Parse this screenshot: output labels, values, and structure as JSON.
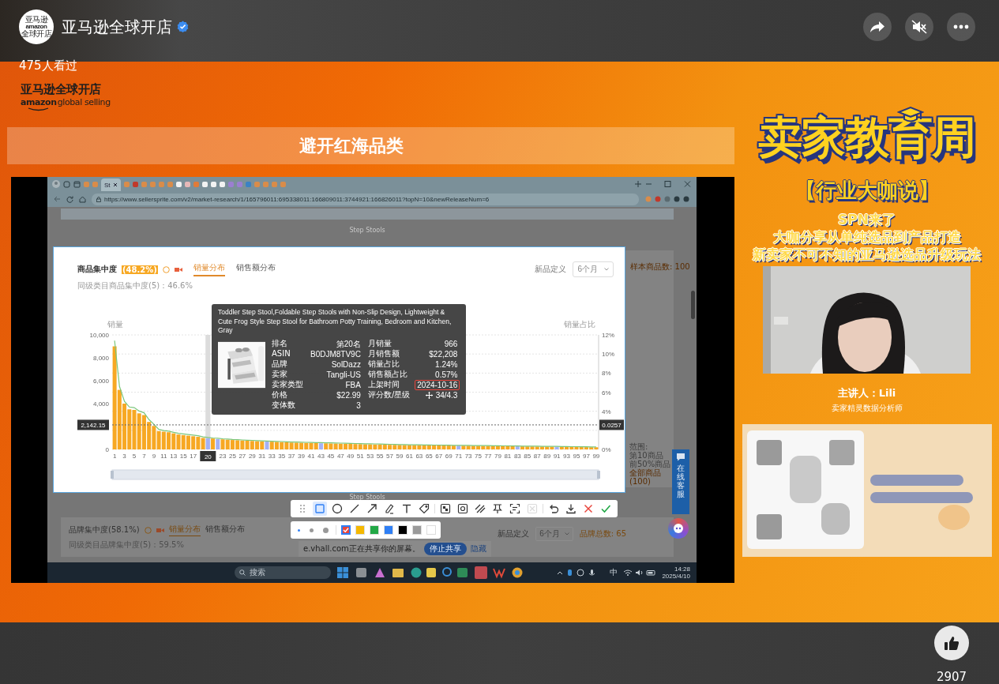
{
  "header": {
    "avatar_text": [
      "亚马逊",
      "amazon",
      "全球开店"
    ],
    "name": "亚马逊全球开店",
    "verified": true
  },
  "actions": [
    {
      "kind": "share"
    },
    {
      "kind": "mute"
    },
    {
      "kind": "more"
    }
  ],
  "views": "475人看过",
  "logo": {
    "cn": "亚马逊全球开店",
    "en_bold": "amazon",
    "en": "global selling"
  },
  "slide_title": "避开红海品类",
  "screen": {
    "browser": {
      "tabs": [
        {
          "label": "St",
          "selected": true
        }
      ],
      "url": "https://www.sellersprite.com/v2/market-research/1/165796011:695338011:166809011:3744921:166826011?topN=10&newReleaseNum=6"
    },
    "top_caption": "Step Stools",
    "concentration_card": {
      "title": "商品集中度",
      "badge": "(48.2%)",
      "tabs": [
        {
          "label": "销量分布",
          "selected": true
        },
        {
          "label": "销售额分布",
          "selected": false
        }
      ],
      "subtitle": "同级类目商品集中度(5)：46.6%",
      "new_def_label": "新品定义",
      "new_def_value": "6个月",
      "right_axis": {
        "label": "销量占比",
        "ticks": [
          "12%",
          "10%",
          "8%",
          "6%",
          "4%",
          "0%"
        ]
      },
      "pointer": {
        "x_label": "20",
        "left_label": "2,142.15",
        "right_label": "0.0257"
      },
      "chart_data": {
        "type": "bar",
        "ylabel": "销量",
        "stacked": true,
        "xlim": [
          0.5,
          99.5
        ],
        "ref_lines": [
          {
            "axis": "y",
            "value": 2142.15
          }
        ],
        "x": [
          1,
          2,
          3,
          4,
          5,
          6,
          7,
          8,
          9,
          10,
          11,
          12,
          13,
          14,
          15,
          16,
          17,
          18,
          19,
          20,
          21,
          22,
          23,
          24,
          25,
          26,
          27,
          28,
          29,
          30,
          31,
          32,
          33,
          34,
          35,
          36,
          37,
          38,
          39,
          40,
          41,
          42,
          43,
          44,
          45,
          46,
          47,
          48,
          49,
          50,
          51,
          52,
          53,
          54,
          55,
          56,
          57,
          58,
          59,
          60,
          61,
          62,
          63,
          64,
          65,
          66,
          67,
          68,
          69,
          70,
          71,
          72,
          73,
          74,
          75,
          76,
          77,
          78,
          79,
          80,
          81,
          82,
          83,
          84,
          85,
          86,
          87,
          88,
          89,
          90,
          91,
          92,
          93,
          94,
          95,
          96,
          97,
          98,
          99
        ],
        "xticks": [
          1,
          3,
          5,
          7,
          9,
          11,
          13,
          15,
          17,
          23,
          25,
          27,
          29,
          31,
          33,
          35,
          37,
          39,
          41,
          43,
          45,
          47,
          49,
          51,
          53,
          55,
          57,
          59,
          61,
          63,
          65,
          67,
          69,
          71,
          73,
          75,
          77,
          79,
          81,
          83,
          85,
          87,
          89,
          91,
          93,
          95,
          97,
          99
        ],
        "ylim": [
          0,
          10000
        ],
        "yticks": [
          {
            "value": 0,
            "label": "0"
          },
          {
            "value": 4000,
            "label": "4,000"
          },
          {
            "value": 6000,
            "label": "6,000"
          },
          {
            "value": 8000,
            "label": "8,000"
          },
          {
            "value": 10000,
            "label": "10,000"
          }
        ],
        "series": [
          {
            "color": "#f7a823",
            "values": [
              9000,
              5200,
              4000,
              3500,
              3450,
              3150,
              3000,
              2400,
              2050,
              1600,
              1550,
              1500,
              1400,
              1300,
              1250,
              1200,
              1150,
              1100,
              1000,
              null,
              950,
              null,
              880,
              850,
              820,
              800,
              780,
              760,
              740,
              720,
              700,
              null,
              680,
              660,
              640,
              620,
              600,
              590,
              580,
              570,
              560,
              550,
              null,
              530,
              520,
              510,
              500,
              490,
              480,
              470,
              460,
              450,
              440,
              430,
              420,
              410,
              400,
              395,
              390,
              385,
              380,
              375,
              370,
              365,
              360,
              355,
              350,
              345,
              340,
              335,
              null,
              325,
              320,
              315,
              310,
              305,
              300,
              295,
              290,
              285,
              280,
              275,
              null,
              265,
              260,
              255,
              250,
              245,
              240,
              235,
              null,
              225,
              220,
              215,
              210,
              205,
              200,
              195,
              190
            ]
          },
          {
            "color": "#a3b1f5",
            "values": [
              null,
              null,
              null,
              null,
              null,
              null,
              null,
              null,
              null,
              null,
              null,
              null,
              null,
              null,
              null,
              null,
              null,
              null,
              null,
              966,
              null,
              900,
              null,
              null,
              null,
              null,
              null,
              null,
              null,
              null,
              null,
              690,
              null,
              null,
              null,
              null,
              null,
              null,
              null,
              null,
              null,
              null,
              540,
              null,
              null,
              null,
              null,
              null,
              null,
              null,
              null,
              null,
              null,
              null,
              null,
              null,
              null,
              null,
              null,
              null,
              null,
              null,
              null,
              null,
              null,
              null,
              null,
              null,
              null,
              null,
              330,
              null,
              null,
              null,
              null,
              null,
              null,
              null,
              null,
              null,
              null,
              null,
              270,
              null,
              null,
              null,
              null,
              null,
              null,
              null,
              230,
              null,
              null,
              null,
              null,
              null,
              null,
              null,
              null
            ]
          },
          {
            "type": "line",
            "color": "#7bc67b",
            "values": [
              9500,
              5500,
              4200,
              3700,
              3650,
              3350,
              3200,
              2600,
              2200,
              1750,
              1650,
              1600,
              1500,
              1400,
              1350,
              1300,
              1250,
              1200,
              1100,
              1050,
              1000,
              970,
              930,
              900,
              870,
              850,
              830,
              810,
              790,
              770,
              750,
              740,
              720,
              700,
              690,
              670,
              650,
              640,
              630,
              620,
              610,
              600,
              590,
              580,
              570,
              560,
              550,
              540,
              530,
              520,
              510,
              500,
              490,
              480,
              470,
              460,
              450,
              440,
              430,
              420,
              410,
              400,
              400,
              390,
              390,
              380,
              380,
              370,
              370,
              360,
              360,
              350,
              350,
              340,
              340,
              330,
              330,
              320,
              320,
              310,
              310,
              300,
              300,
              290,
              290,
              280,
              280,
              270,
              270,
              260,
              260,
              250,
              250,
              240,
              240,
              230,
              230,
              220,
              220
            ]
          }
        ]
      },
      "tooltip": {
        "title": "Toddler Step Stool,Foldable Step Stools with Non-Slip Design, Lightweight & Cute Frog Style Step Stool for Bathroom Potty Training, Bedroom and Kitchen, Gray",
        "left": [
          {
            "label": "排名",
            "value": "第20名"
          },
          {
            "label": "ASIN",
            "value": "B0DJM8TV9C"
          },
          {
            "label": "品牌",
            "value": "SolDazz"
          },
          {
            "label": "卖家",
            "value": "Tangli-US"
          },
          {
            "label": "卖家类型",
            "value": "FBA"
          },
          {
            "label": "价格",
            "value": "$22.99"
          },
          {
            "label": "变体数",
            "value": "3"
          }
        ],
        "right": [
          {
            "label": "月销量",
            "value": "966",
            "highlighted": false
          },
          {
            "label": "月销售额",
            "value": "$22,208",
            "highlighted": false
          },
          {
            "label": "销量占比",
            "value": "1.24%",
            "highlighted": false
          },
          {
            "label": "销售额占比",
            "value": "0.57%",
            "highlighted": false
          },
          {
            "label": "上架时间",
            "value": "2024-10-16",
            "highlighted": true
          },
          {
            "label": "评分数/星级",
            "value": "34/4.3",
            "highlighted": false
          }
        ]
      }
    },
    "sample_count": "样本商品数: 100",
    "range_legend": {
      "title": "范围:",
      "items": [
        "第10商品",
        "前50%商品",
        "全部商品(100)"
      ]
    },
    "bottom_caption": "Step Stools",
    "brand_card": {
      "title": "品牌集中度(58.1%)",
      "tabs": [
        {
          "label": "销量分布",
          "selected": true
        },
        {
          "label": "销售额分布",
          "selected": false
        }
      ],
      "subtitle": "同级类目品牌集中度(5)：59.5%",
      "new_def_label": "新品定义",
      "new_def_value": "6个月",
      "brand_count": "品牌总数: 65"
    },
    "support": "在线客服",
    "toolbar": {
      "tools": [
        {
          "kind": "drag",
          "selected": false,
          "disabled": false
        },
        {
          "kind": "rect",
          "selected": true,
          "disabled": false
        },
        {
          "kind": "ellipse",
          "selected": false,
          "disabled": false
        },
        {
          "kind": "line",
          "selected": false,
          "disabled": false
        },
        {
          "kind": "arrow",
          "selected": false,
          "disabled": false
        },
        {
          "kind": "pen",
          "selected": false,
          "disabled": false
        },
        {
          "kind": "text",
          "selected": false,
          "disabled": false
        },
        {
          "kind": "tag",
          "selected": false,
          "disabled": false
        },
        {
          "kind": "mosaic",
          "selected": false,
          "disabled": false
        },
        {
          "kind": "blur",
          "selected": false,
          "disabled": false
        },
        {
          "kind": "hatch",
          "selected": false,
          "disabled": false
        },
        {
          "kind": "pin",
          "selected": false,
          "disabled": false
        },
        {
          "kind": "ocr",
          "selected": false,
          "disabled": false
        },
        {
          "kind": "translate",
          "selected": false,
          "disabled": true
        },
        {
          "kind": "undo",
          "selected": false,
          "disabled": false
        },
        {
          "kind": "download",
          "selected": false,
          "disabled": false
        },
        {
          "kind": "cancel",
          "selected": false,
          "disabled": false
        },
        {
          "kind": "confirm",
          "selected": false,
          "disabled": false
        }
      ]
    },
    "palette": {
      "sizes": [
        {
          "kind": "small",
          "selected": true
        },
        {
          "kind": "medium",
          "selected": false
        },
        {
          "kind": "large",
          "selected": false
        }
      ],
      "colors": [
        {
          "color": "#e8453c",
          "selected": true
        },
        {
          "color": "#f5b800",
          "selected": false
        },
        {
          "color": "#22a846",
          "selected": false
        },
        {
          "color": "#2f7ff5",
          "selected": false
        },
        {
          "color": "#000000",
          "selected": false
        },
        {
          "color": "#9a9a9a",
          "selected": false
        },
        {
          "color": "#ffffff",
          "selected": false
        }
      ]
    },
    "share_notice": {
      "text": "e.vhall.com正在共享你的屏幕。",
      "stop": "停止共享",
      "hide": "隐藏"
    },
    "taskbar": {
      "search_placeholder": "搜索",
      "ime": "中",
      "time": "14:28",
      "date": "2025/4/10"
    }
  },
  "promo": {
    "title": "卖家教育周",
    "subtitle": "【行业大咖说】",
    "lines": [
      "SPN来了",
      "大咖分享从单纯选品到产品打造",
      "新卖家不可不知的亚马逊选品升级玩法"
    ],
    "video": {
      "kind": "picture"
    },
    "speaker": "主讲人：Lili",
    "speaker_role": "卖家精灵数据分析师",
    "qr": {
      "kind": "picture"
    }
  },
  "likes": "2907"
}
